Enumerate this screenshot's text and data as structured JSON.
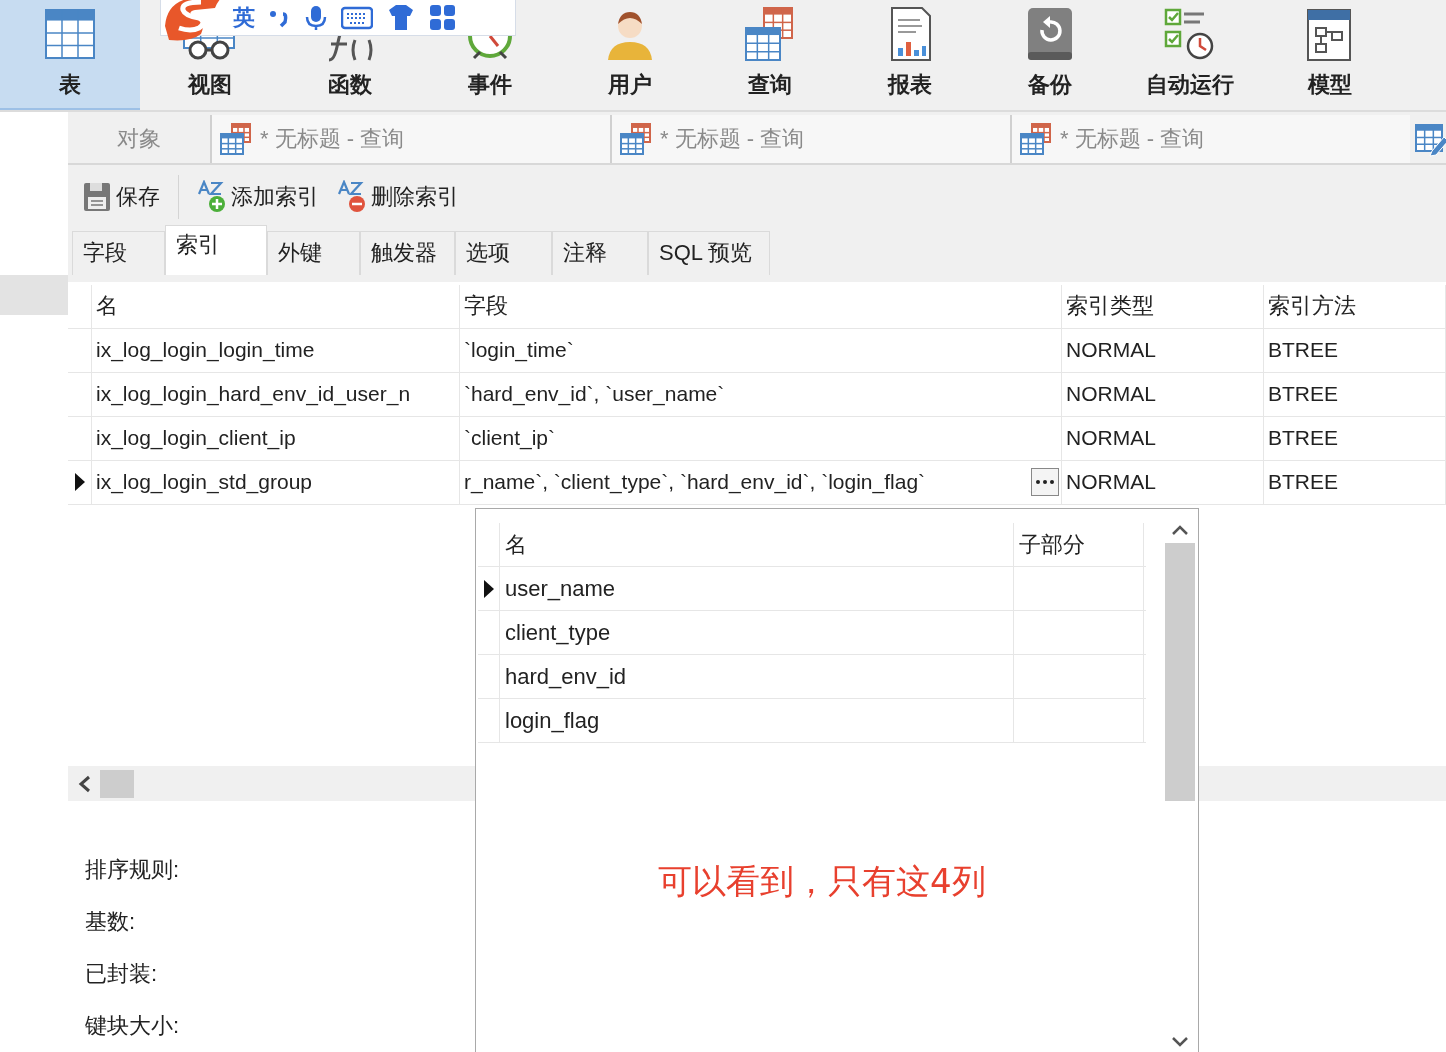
{
  "ribbon": {
    "items": [
      {
        "label": "表",
        "kind": "table",
        "selected": true
      },
      {
        "label": "视图",
        "kind": "view",
        "selected": false
      },
      {
        "label": "函数",
        "kind": "function",
        "selected": false
      },
      {
        "label": "事件",
        "kind": "event",
        "selected": false
      },
      {
        "label": "用户",
        "kind": "user",
        "selected": false
      },
      {
        "label": "查询",
        "kind": "query",
        "selected": false
      },
      {
        "label": "报表",
        "kind": "report",
        "selected": false
      },
      {
        "label": "备份",
        "kind": "backup",
        "selected": false
      },
      {
        "label": "自动运行",
        "kind": "automation",
        "selected": false
      },
      {
        "label": "模型",
        "kind": "model",
        "selected": false
      }
    ]
  },
  "ime_toolbar": {
    "language": "英"
  },
  "document_tabs": [
    {
      "label": "对象",
      "kind": "objects"
    },
    {
      "label": "* 无标题 - 查询",
      "kind": "query"
    },
    {
      "label": "* 无标题 - 查询",
      "kind": "query"
    },
    {
      "label": "* 无标题 - 查询",
      "kind": "query"
    }
  ],
  "toolbar": {
    "buttons": [
      {
        "label": "保存",
        "kind": "save"
      },
      {
        "label": "添加索引",
        "kind": "add"
      },
      {
        "label": "删除索引",
        "kind": "delete"
      }
    ]
  },
  "editor_tabs": [
    {
      "label": "字段",
      "selected": false
    },
    {
      "label": "索引",
      "selected": true
    },
    {
      "label": "外键",
      "selected": false
    },
    {
      "label": "触发器",
      "selected": false
    },
    {
      "label": "选项",
      "selected": false
    },
    {
      "label": "注释",
      "selected": false
    },
    {
      "label": "SQL 预览",
      "selected": false
    }
  ],
  "index_table": {
    "columns": [
      "名",
      "字段",
      "索引类型",
      "索引方法"
    ],
    "rows": [
      {
        "cells": [
          "ix_log_login_login_time",
          "`login_time`",
          "NORMAL",
          "BTREE"
        ],
        "current": false
      },
      {
        "cells": [
          "ix_log_login_hard_env_id_user_n",
          "`hard_env_id`, `user_name`",
          "NORMAL",
          "BTREE"
        ],
        "current": false
      },
      {
        "cells": [
          "ix_log_login_client_ip",
          "`client_ip`",
          "NORMAL",
          "BTREE"
        ],
        "current": false
      },
      {
        "cells": [
          "ix_log_login_std_group",
          "r_name`, `client_type`, `hard_env_id`, `login_flag`",
          "NORMAL",
          "BTREE"
        ],
        "current": true
      }
    ]
  },
  "popup": {
    "columns": [
      "名",
      "子部分"
    ],
    "rows": [
      {
        "name": "user_name",
        "current": true
      },
      {
        "name": "client_type",
        "current": false
      },
      {
        "name": "hard_env_id",
        "current": false
      },
      {
        "name": "login_flag",
        "current": false
      }
    ]
  },
  "annotation": "可以看到，只有这4列",
  "properties": [
    {
      "label": "排序规则:"
    },
    {
      "label": "基数:"
    },
    {
      "label": "已封装:"
    },
    {
      "label": "键块大小:"
    }
  ]
}
